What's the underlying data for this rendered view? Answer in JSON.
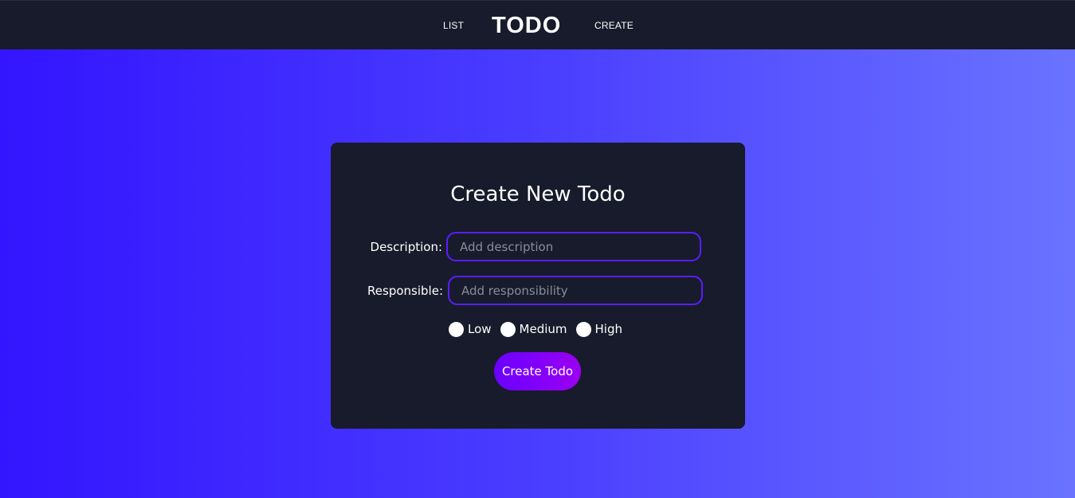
{
  "nav": {
    "list_label": "LIST",
    "brand": "TODO",
    "create_label": "CREATE"
  },
  "form": {
    "title": "Create New Todo",
    "description": {
      "label": "Description:",
      "placeholder": "Add description",
      "value": ""
    },
    "responsible": {
      "label": "Responsible:",
      "placeholder": "Add responsibility",
      "value": ""
    },
    "priority": {
      "options": [
        "Low",
        "Medium",
        "High"
      ],
      "selected": null
    },
    "submit_label": "Create Todo"
  },
  "colors": {
    "navbar_bg": "#181b2b",
    "card_bg": "#181b2b",
    "gradient_start": "#3315ff",
    "gradient_end": "#6a73ff",
    "input_border": "#5b1dff",
    "button_gradient_start": "#6a00ff",
    "button_gradient_end": "#9b00f2"
  }
}
